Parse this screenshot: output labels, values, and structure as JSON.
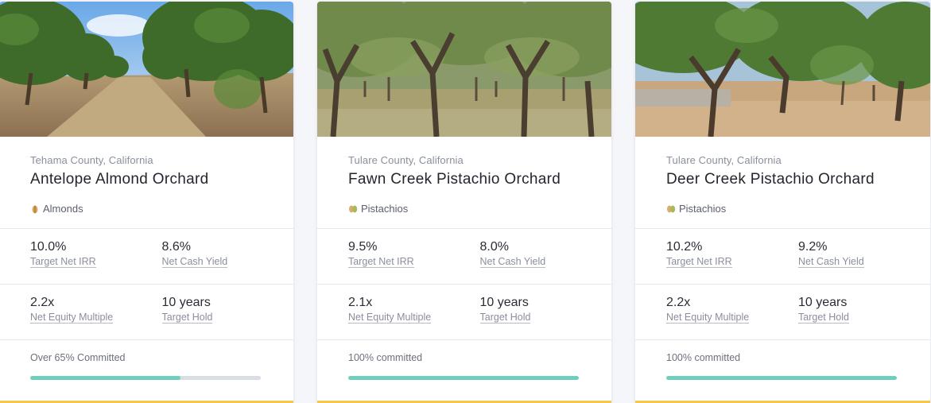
{
  "cards": [
    {
      "location": "Tehama County, California",
      "title": "Antelope Almond Orchard",
      "crop_icon": "almond-icon",
      "crop": "Almonds",
      "metrics": [
        {
          "value": "10.0%",
          "label": "Target Net IRR"
        },
        {
          "value": "8.6%",
          "label": "Net Cash Yield"
        },
        {
          "value": "2.2x",
          "label": "Net Equity Multiple"
        },
        {
          "value": "10 years",
          "label": "Target Hold"
        }
      ],
      "committed_text": "Over 65% Committed",
      "committed_fraction": 0.65
    },
    {
      "location": "Tulare County, California",
      "title": "Fawn Creek Pistachio Orchard",
      "crop_icon": "pistachio-icon",
      "crop": "Pistachios",
      "metrics": [
        {
          "value": "9.5%",
          "label": "Target Net IRR"
        },
        {
          "value": "8.0%",
          "label": "Net Cash Yield"
        },
        {
          "value": "2.1x",
          "label": "Net Equity Multiple"
        },
        {
          "value": "10 years",
          "label": "Target Hold"
        }
      ],
      "committed_text": "100% committed",
      "committed_fraction": 1.0
    },
    {
      "location": "Tulare County, California",
      "title": "Deer Creek Pistachio Orchard",
      "crop_icon": "pistachio-icon",
      "crop": "Pistachios",
      "metrics": [
        {
          "value": "10.2%",
          "label": "Target Net IRR"
        },
        {
          "value": "9.2%",
          "label": "Net Cash Yield"
        },
        {
          "value": "2.2x",
          "label": "Net Equity Multiple"
        },
        {
          "value": "10 years",
          "label": "Target Hold"
        }
      ],
      "committed_text": "100% committed",
      "committed_fraction": 1.0
    }
  ],
  "colors": {
    "progress_fill": "#6fcfbd",
    "progress_track": "#d9dde6",
    "card_accent": "#f2c94c"
  }
}
